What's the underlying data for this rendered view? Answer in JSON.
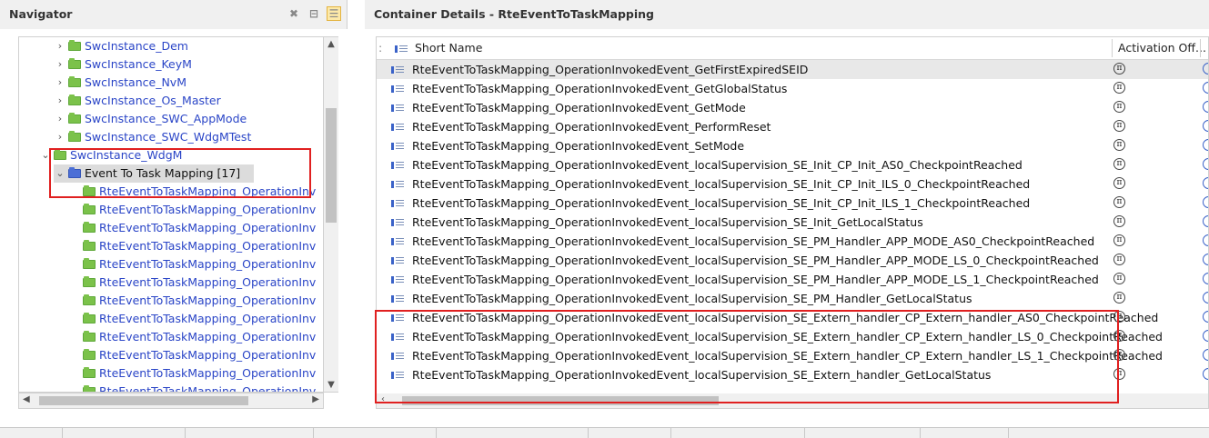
{
  "navigator": {
    "title": "Navigator",
    "tree": [
      {
        "label": "SwcInstance_Dem",
        "indent": 1,
        "expanded": false,
        "folder": "green",
        "color": "link"
      },
      {
        "label": "SwcInstance_KeyM",
        "indent": 1,
        "expanded": false,
        "folder": "green",
        "color": "link"
      },
      {
        "label": "SwcInstance_NvM",
        "indent": 1,
        "expanded": false,
        "folder": "green",
        "color": "link"
      },
      {
        "label": "SwcInstance_Os_Master",
        "indent": 1,
        "expanded": false,
        "folder": "green",
        "color": "link"
      },
      {
        "label": "SwcInstance_SWC_AppMode",
        "indent": 1,
        "expanded": false,
        "folder": "green",
        "color": "link"
      },
      {
        "label": "SwcInstance_SWC_WdgMTest",
        "indent": 1,
        "expanded": false,
        "folder": "green",
        "color": "link"
      },
      {
        "label": "SwcInstance_WdgM",
        "indent": 0,
        "expanded": true,
        "folder": "green",
        "color": "link"
      },
      {
        "label": "Event To Task Mapping [17]",
        "indent": 1,
        "expanded": true,
        "folder": "blue",
        "color": "black",
        "selected": true
      },
      {
        "label": "RteEventToTaskMapping_OperationInv",
        "indent": 2,
        "folder": "green",
        "color": "link"
      },
      {
        "label": "RteEventToTaskMapping_OperationInv",
        "indent": 2,
        "folder": "green",
        "color": "link"
      },
      {
        "label": "RteEventToTaskMapping_OperationInv",
        "indent": 2,
        "folder": "green",
        "color": "link"
      },
      {
        "label": "RteEventToTaskMapping_OperationInv",
        "indent": 2,
        "folder": "green",
        "color": "link"
      },
      {
        "label": "RteEventToTaskMapping_OperationInv",
        "indent": 2,
        "folder": "green",
        "color": "link"
      },
      {
        "label": "RteEventToTaskMapping_OperationInv",
        "indent": 2,
        "folder": "green",
        "color": "link"
      },
      {
        "label": "RteEventToTaskMapping_OperationInv",
        "indent": 2,
        "folder": "green",
        "color": "link"
      },
      {
        "label": "RteEventToTaskMapping_OperationInv",
        "indent": 2,
        "folder": "green",
        "color": "link"
      },
      {
        "label": "RteEventToTaskMapping_OperationInv",
        "indent": 2,
        "folder": "green",
        "color": "link"
      },
      {
        "label": "RteEventToTaskMapping_OperationInv",
        "indent": 2,
        "folder": "green",
        "color": "link"
      },
      {
        "label": "RteEventToTaskMapping_OperationInv",
        "indent": 2,
        "folder": "green",
        "color": "link"
      },
      {
        "label": "RteEventToTaskMapping_OperationInv",
        "indent": 2,
        "folder": "green",
        "color": "link"
      }
    ]
  },
  "container": {
    "title": "Container Details - RteEventToTaskMapping",
    "columns": {
      "short_name": "Short Name",
      "activation": "Activation Off..."
    },
    "rows": [
      "RteEventToTaskMapping_OperationInvokedEvent_GetFirstExpiredSEID",
      "RteEventToTaskMapping_OperationInvokedEvent_GetGlobalStatus",
      "RteEventToTaskMapping_OperationInvokedEvent_GetMode",
      "RteEventToTaskMapping_OperationInvokedEvent_PerformReset",
      "RteEventToTaskMapping_OperationInvokedEvent_SetMode",
      "RteEventToTaskMapping_OperationInvokedEvent_localSupervision_SE_Init_CP_Init_AS0_CheckpointReached",
      "RteEventToTaskMapping_OperationInvokedEvent_localSupervision_SE_Init_CP_Init_ILS_0_CheckpointReached",
      "RteEventToTaskMapping_OperationInvokedEvent_localSupervision_SE_Init_CP_Init_ILS_1_CheckpointReached",
      "RteEventToTaskMapping_OperationInvokedEvent_localSupervision_SE_Init_GetLocalStatus",
      "RteEventToTaskMapping_OperationInvokedEvent_localSupervision_SE_PM_Handler_APP_MODE_AS0_CheckpointReached",
      "RteEventToTaskMapping_OperationInvokedEvent_localSupervision_SE_PM_Handler_APP_MODE_LS_0_CheckpointReached",
      "RteEventToTaskMapping_OperationInvokedEvent_localSupervision_SE_PM_Handler_APP_MODE_LS_1_CheckpointReached",
      "RteEventToTaskMapping_OperationInvokedEvent_localSupervision_SE_PM_Handler_GetLocalStatus",
      "RteEventToTaskMapping_OperationInvokedEvent_localSupervision_SE_Extern_handler_CP_Extern_handler_AS0_CheckpointReached",
      "RteEventToTaskMapping_OperationInvokedEvent_localSupervision_SE_Extern_handler_CP_Extern_handler_LS_0_CheckpointReached",
      "RteEventToTaskMapping_OperationInvokedEvent_localSupervision_SE_Extern_handler_CP_Extern_handler_LS_1_CheckpointReached",
      "RteEventToTaskMapping_OperationInvokedEvent_localSupervision_SE_Extern_handler_GetLocalStatus"
    ],
    "activation_symbol": "π"
  },
  "colors": {
    "link": "#2a45c7",
    "highlight": "#e02020"
  }
}
